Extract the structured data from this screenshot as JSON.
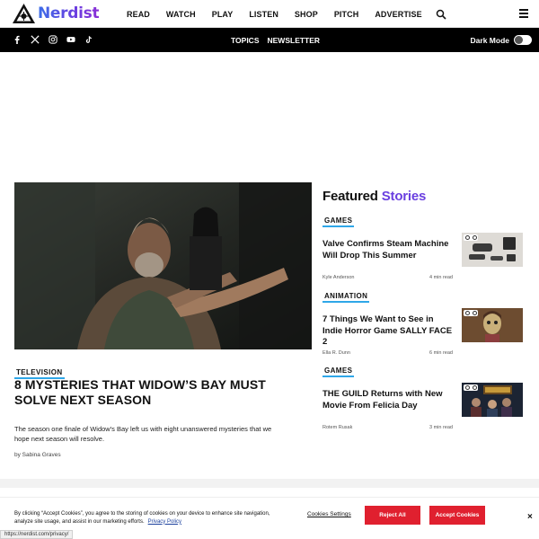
{
  "brand": {
    "name": "Nerdist"
  },
  "nav": [
    "READ",
    "WATCH",
    "PLAY",
    "LISTEN",
    "SHOP",
    "PITCH",
    "ADVERTISE"
  ],
  "subnav": {
    "topics": "TOPICS",
    "newsletter": "NEWSLETTER",
    "dark_mode_label": "Dark Mode"
  },
  "social_icons": [
    "facebook-icon",
    "x-icon",
    "instagram-icon",
    "youtube-icon",
    "tiktok-icon"
  ],
  "hero": {
    "category": "TELEVISION",
    "title": "8 MYSTERIES THAT WIDOW’S BAY MUST SOLVE NEXT SEASON",
    "description": "The season one finale of Widow's Bay left us with eight unanswered mysteries that we hope next season will resolve.",
    "author": "by Sabina Graves"
  },
  "featured": {
    "title_main": "Featured",
    "title_accent": "Stories",
    "stories": [
      {
        "category": "GAMES",
        "title": "Valve Confirms Steam Machine Will Drop This Summer",
        "author": "Kyle Anderson",
        "read_time": "4 min read"
      },
      {
        "category": "ANIMATION",
        "title": "7 Things We Want to See in Indie Horror Game SALLY FACE 2",
        "author": "Ella R. Dunn",
        "read_time": "6 min read"
      },
      {
        "category": "GAMES",
        "title": "THE GUILD Returns with New Movie From Felicia Day",
        "author": "Rotem Rusak",
        "read_time": "3 min read"
      }
    ]
  },
  "cookie": {
    "text": "By clicking “Accept Cookies”, you agree to the storing of cookies on your device to enhance site navigation, analyze site usage, and assist in our marketing efforts.",
    "policy_link": "Privacy Policy",
    "settings": "Cookies Settings",
    "reject": "Reject All",
    "accept": "Accept Cookies",
    "close": "×"
  },
  "status_url": "https://nerdist.com/privacy/",
  "colors": {
    "accent_purple": "#6a3fe0",
    "category_underline": "#2fa7e8",
    "cookie_red": "#e0202f"
  }
}
